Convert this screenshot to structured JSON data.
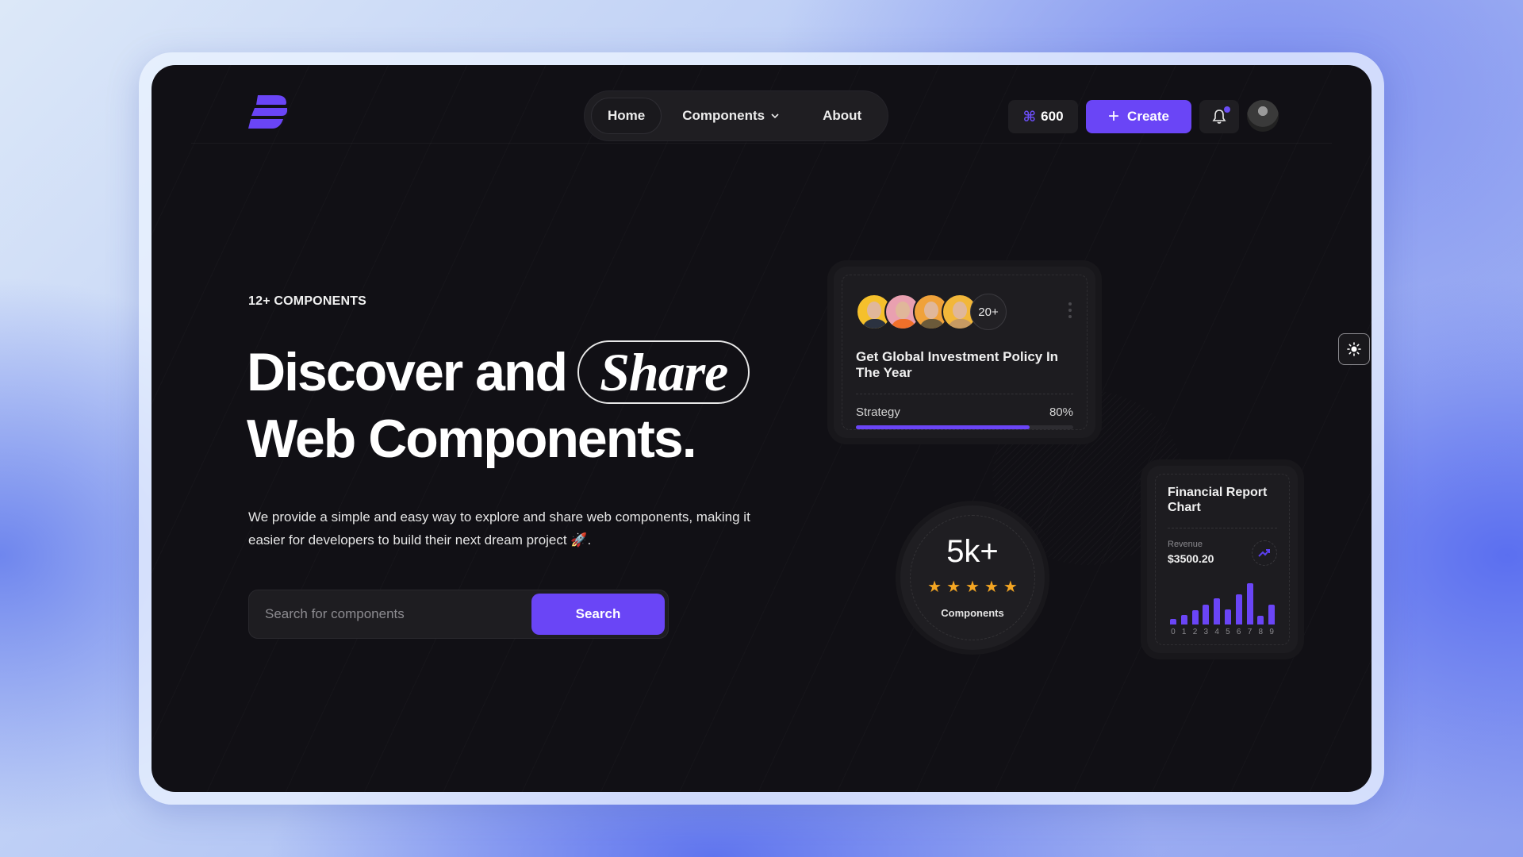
{
  "brand": {
    "logo": "brand-logo",
    "accent": "#6a45f6"
  },
  "nav": {
    "items": [
      {
        "label": "Home",
        "active": true
      },
      {
        "label": "Components",
        "has_dropdown": true
      },
      {
        "label": "About"
      }
    ]
  },
  "header": {
    "credits_icon": "command-icon",
    "credits_value": "600",
    "create_label": "Create",
    "notification_icon": "bell-icon",
    "has_unread": true
  },
  "hero": {
    "eyebrow": "12+ COMPONENTS",
    "title_part1": "Discover and",
    "title_highlight": "Share",
    "title_line2": "Web Components.",
    "description": "We provide a simple and easy way to explore and share web components, making it easier for developers to build their next dream project 🚀.",
    "search_placeholder": "Search for components",
    "search_button": "Search"
  },
  "investment_card": {
    "avatar_count": 4,
    "avatars": [
      "#f5c02b",
      "#e9a0b0",
      "#f0a23a",
      "#f2b73a"
    ],
    "more_label": "20+",
    "title": "Get Global Investment Policy In The Year",
    "progress_label": "Strategy",
    "progress_text": "80%",
    "progress_value": 0.8
  },
  "rating_card": {
    "value": "5k+",
    "stars": 5,
    "label": "Components"
  },
  "financial_card": {
    "title": "Financial Report Chart",
    "revenue_label": "Revenue",
    "revenue_value": "$3500.20",
    "trend_icon": "trending-up-icon",
    "chart_data": {
      "type": "bar",
      "categories": [
        "0",
        "1",
        "2",
        "3",
        "4",
        "5",
        "6",
        "7",
        "8",
        "9"
      ],
      "values": [
        8,
        13,
        19,
        27,
        35,
        20,
        41,
        56,
        12,
        27
      ],
      "ylim": [
        0,
        60
      ]
    }
  },
  "theme_toggle": {
    "icon": "sun-icon"
  }
}
